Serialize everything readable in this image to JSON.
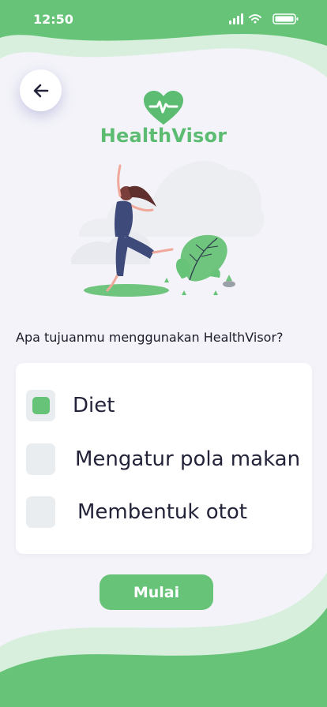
{
  "status_bar": {
    "time": "12:50"
  },
  "brand": {
    "name": "HealthVisor"
  },
  "question": "Apa tujuanmu menggunakan HealthVisor?",
  "options": [
    {
      "label": "Diet",
      "checked": true
    },
    {
      "label": "Mengatur pola makan",
      "checked": false
    },
    {
      "label": "Membentuk otot",
      "checked": false
    }
  ],
  "submit_label": "Mulai",
  "colors": {
    "accent": "#66c378",
    "brand_text": "#5cbd72",
    "background": "#f3f3f9",
    "text": "#23233a"
  },
  "icons": {
    "back": "arrow-left-icon",
    "logo": "heart-pulse-icon"
  }
}
